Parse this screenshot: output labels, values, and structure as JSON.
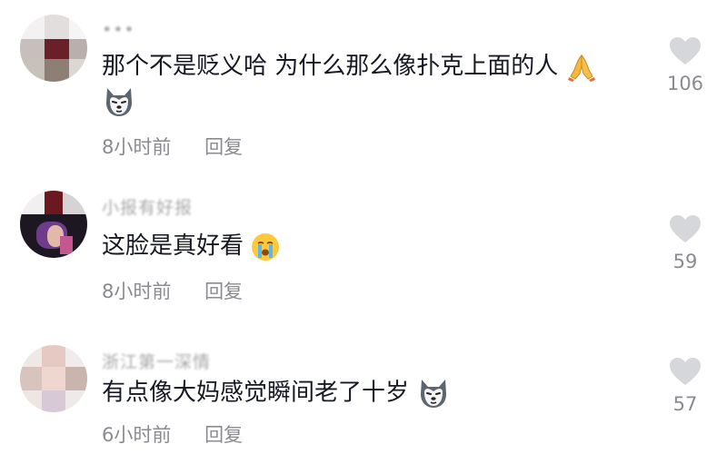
{
  "comments": [
    {
      "username": "•••",
      "text": "那个不是贬义哈 为什么那么像扑克上面的人",
      "emojis": [
        "praying-hands-icon",
        "husky-dog-icon"
      ],
      "time": "8小时前",
      "reply_label": "回复",
      "likes": "106"
    },
    {
      "username": "小报有好报",
      "text": "这脸是真好看",
      "emojis": [
        "crying-face-icon"
      ],
      "time": "8小时前",
      "reply_label": "回复",
      "likes": "59"
    },
    {
      "username": "浙江第一深情",
      "text": "有点像大妈感觉瞬间老了十岁",
      "emojis": [
        "husky-dog-icon"
      ],
      "time": "6小时前",
      "reply_label": "回复",
      "likes": "57"
    }
  ]
}
